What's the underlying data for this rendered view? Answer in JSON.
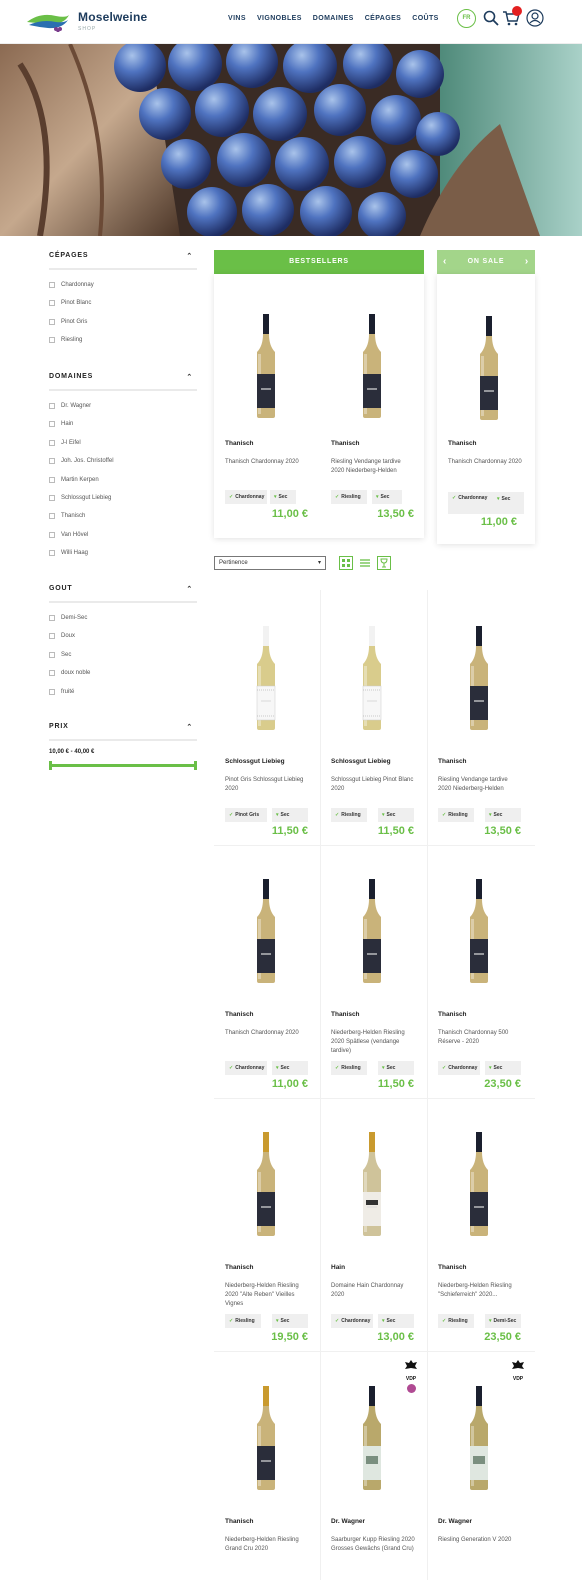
{
  "brand": {
    "name": "Moselweine",
    "tagline": "SHOP"
  },
  "nav": [
    "VINS",
    "VIGNOBLES",
    "DOMAINES",
    "CÉPAGES",
    "COÛTS"
  ],
  "lang": "FR",
  "filters": {
    "cepages": {
      "title": "CÉPAGES",
      "options": [
        "Chardonnay",
        "Pinot Blanc",
        "Pinot Gris",
        "Riesling"
      ]
    },
    "domaines": {
      "title": "DOMAINES",
      "options": [
        "Dr. Wagner",
        "Hain",
        "J-l Eifel",
        "Joh. Jos. Christoffel",
        "Martin Kerpen",
        "Schlossgut Liebieg",
        "Thanisch",
        "Van Hövel",
        "Willi Haag"
      ]
    },
    "gout": {
      "title": "GOUT",
      "options": [
        "Demi-Sec",
        "Doux",
        "Sec",
        "doux noble",
        "fruité"
      ]
    },
    "prix": {
      "title": "PRIX",
      "range": "10,00 € - 40,00 €"
    }
  },
  "bestsellers": {
    "title": "BESTSELLERS",
    "items": [
      {
        "winery": "Thanisch",
        "name": "Thanisch Chardonnay 2020",
        "grape": "Chardonnay",
        "taste": "Sec",
        "price": "11,00 €"
      },
      {
        "winery": "Thanisch",
        "name": "Riesling Vendange tardive 2020 Niederberg-Helden",
        "grape": "Riesling",
        "taste": "Sec",
        "price": "13,50 €"
      }
    ]
  },
  "on_sale": {
    "title": "ON SALE",
    "item": {
      "winery": "Thanisch",
      "name": "Thanisch Chardonnay 2020",
      "grape": "Chardonnay",
      "taste": "Sec",
      "price": "11,00 €"
    }
  },
  "sort": {
    "selected": "Pertinence"
  },
  "products": [
    {
      "winery": "Schlossgut Liebieg",
      "name": "Pinot Gris Schlossgut Liebieg 2020",
      "grape": "Pinot Gris",
      "taste": "Sec",
      "price": "11,50 €"
    },
    {
      "winery": "Schlossgut Liebieg",
      "name": "Schlossgut Liebieg Pinot Blanc 2020",
      "grape": "Riesling",
      "taste": "Sec",
      "price": "11,50 €"
    },
    {
      "winery": "Thanisch",
      "name": "Riesling Vendange tardive 2020 Niederberg-Helden",
      "grape": "Riesling",
      "taste": "Sec",
      "price": "13,50 €"
    },
    {
      "winery": "Thanisch",
      "name": "Thanisch Chardonnay 2020",
      "grape": "Chardonnay",
      "taste": "Sec",
      "price": "11,00 €"
    },
    {
      "winery": "Thanisch",
      "name": "Niederberg-Helden Riesling 2020 Spätlese (vendange tardive)",
      "grape": "Riesling",
      "taste": "Sec",
      "price": "11,50 €"
    },
    {
      "winery": "Thanisch",
      "name": "Thanisch Chardonnay 500 Réserve - 2020",
      "grape": "Chardonnay",
      "taste": "Sec",
      "price": "23,50 €"
    },
    {
      "winery": "Thanisch",
      "name": "Niederberg-Helden Riesling 2020 \"Alte Reben\" Vieilles Vignes",
      "grape": "Riesling",
      "taste": "Sec",
      "price": "19,50 €"
    },
    {
      "winery": "Hain",
      "name": "Domaine Hain Chardonnay 2020",
      "grape": "Chardonnay",
      "taste": "Sec",
      "price": "13,00 €"
    },
    {
      "winery": "Thanisch",
      "name": "Niederberg-Helden Riesling \"Schieferreich\" 2020...",
      "grape": "Riesling",
      "taste": "Demi-Sec",
      "price": "23,50 €"
    },
    {
      "winery": "Thanisch",
      "name": "Niederberg-Helden Riesling Grand Cru 2020"
    },
    {
      "winery": "Dr. Wagner",
      "name": "Saarburger Kupp Riesling 2020 Grosses Gewächs (Grand Cru)"
    },
    {
      "winery": "Dr. Wagner",
      "name": "Riesling Generation V 2020"
    }
  ],
  "vdp_label": "VDP",
  "colors": {
    "green": "#6abf47",
    "navy": "#1d3b5c",
    "sale_green": "#a3d58a"
  }
}
